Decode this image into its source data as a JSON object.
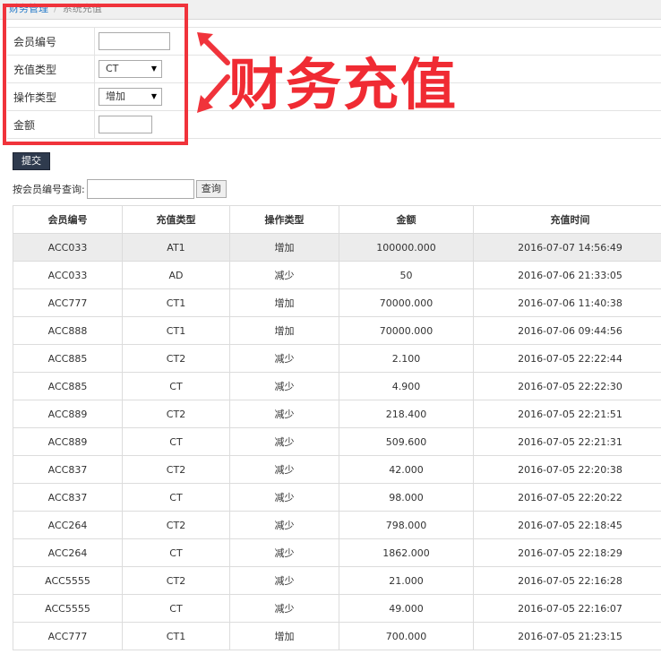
{
  "breadcrumb": {
    "parent": "财务管理",
    "separator": "/",
    "current": "系统充值"
  },
  "form": {
    "member_id_label": "会员编号",
    "member_id_value": "",
    "recharge_type_label": "充值类型",
    "recharge_type_value": "CT",
    "operation_type_label": "操作类型",
    "operation_type_value": "增加",
    "amount_label": "金额",
    "amount_value": ""
  },
  "annotation": {
    "text": "财务充值",
    "color": "#f02b33"
  },
  "submit_label": "提交",
  "search": {
    "label": "按会员编号查询:",
    "value": "",
    "button_label": "查询"
  },
  "table": {
    "headers": [
      "会员编号",
      "充值类型",
      "操作类型",
      "金额",
      "充值时间"
    ],
    "rows": [
      [
        "ACC033",
        "AT1",
        "增加",
        "100000.000",
        "2016-07-07 14:56:49"
      ],
      [
        "ACC033",
        "AD",
        "减少",
        "50",
        "2016-07-06 21:33:05"
      ],
      [
        "ACC777",
        "CT1",
        "增加",
        "70000.000",
        "2016-07-06 11:40:38"
      ],
      [
        "ACC888",
        "CT1",
        "增加",
        "70000.000",
        "2016-07-06 09:44:56"
      ],
      [
        "ACC885",
        "CT2",
        "减少",
        "2.100",
        "2016-07-05 22:22:44"
      ],
      [
        "ACC885",
        "CT",
        "减少",
        "4.900",
        "2016-07-05 22:22:30"
      ],
      [
        "ACC889",
        "CT2",
        "减少",
        "218.400",
        "2016-07-05 22:21:51"
      ],
      [
        "ACC889",
        "CT",
        "减少",
        "509.600",
        "2016-07-05 22:21:31"
      ],
      [
        "ACC837",
        "CT2",
        "减少",
        "42.000",
        "2016-07-05 22:20:38"
      ],
      [
        "ACC837",
        "CT",
        "减少",
        "98.000",
        "2016-07-05 22:20:22"
      ],
      [
        "ACC264",
        "CT2",
        "减少",
        "798.000",
        "2016-07-05 22:18:45"
      ],
      [
        "ACC264",
        "CT",
        "减少",
        "1862.000",
        "2016-07-05 22:18:29"
      ],
      [
        "ACC5555",
        "CT2",
        "减少",
        "21.000",
        "2016-07-05 22:16:28"
      ],
      [
        "ACC5555",
        "CT",
        "减少",
        "49.000",
        "2016-07-05 22:16:07"
      ],
      [
        "ACC777",
        "CT1",
        "增加",
        "700.000",
        "2016-07-05 21:23:15"
      ]
    ]
  },
  "colors": {
    "accent": "#1f77c8",
    "highlight_red": "#f0333b",
    "button_dark": "#2f3b4e"
  }
}
